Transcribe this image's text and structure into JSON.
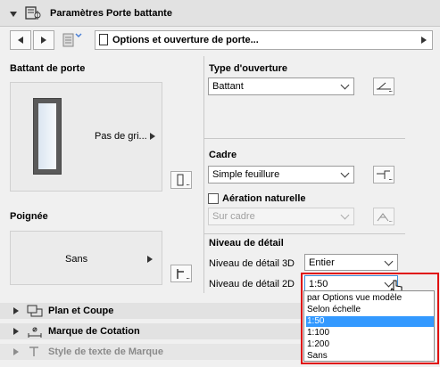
{
  "header": {
    "title": "Paramètres Porte battante"
  },
  "nav": {
    "page_label": "Options et ouverture de porte..."
  },
  "left": {
    "battant_label": "Battant de porte",
    "battant_preview": "Pas de gri...",
    "poignee_label": "Poignée",
    "poignee_preview": "Sans"
  },
  "right": {
    "type_label": "Type d'ouverture",
    "type_value": "Battant",
    "cadre_label": "Cadre",
    "cadre_value": "Simple feuillure",
    "aeration_label": "Aération naturelle",
    "aeration_checked": false,
    "aeration_value": "Sur cadre",
    "niveau_label": "Niveau de détail",
    "niveau3d_label": "Niveau de détail 3D",
    "niveau3d_value": "Entier",
    "niveau2d_label": "Niveau de détail 2D",
    "niveau2d_value": "1:50"
  },
  "dropdown": {
    "options": [
      "par Options vue modèle",
      "Selon échelle",
      "1:50",
      "1:100",
      "1:200",
      "Sans"
    ],
    "selected_index": 2
  },
  "sections": {
    "plan": "Plan et Coupe",
    "cotation": "Marque de Cotation",
    "style": "Style de texte de Marque"
  },
  "colors": {
    "selection": "#3399ff",
    "highlight_border": "#e01010"
  },
  "icons": [
    "door-settings-icon",
    "prev-icon",
    "next-icon",
    "page-list-icon",
    "door-icon",
    "opening-type-icon",
    "frame-icon",
    "ventilation-icon",
    "handle-icon",
    "plan-section-icon",
    "dimension-marker-icon",
    "text-style-icon"
  ]
}
